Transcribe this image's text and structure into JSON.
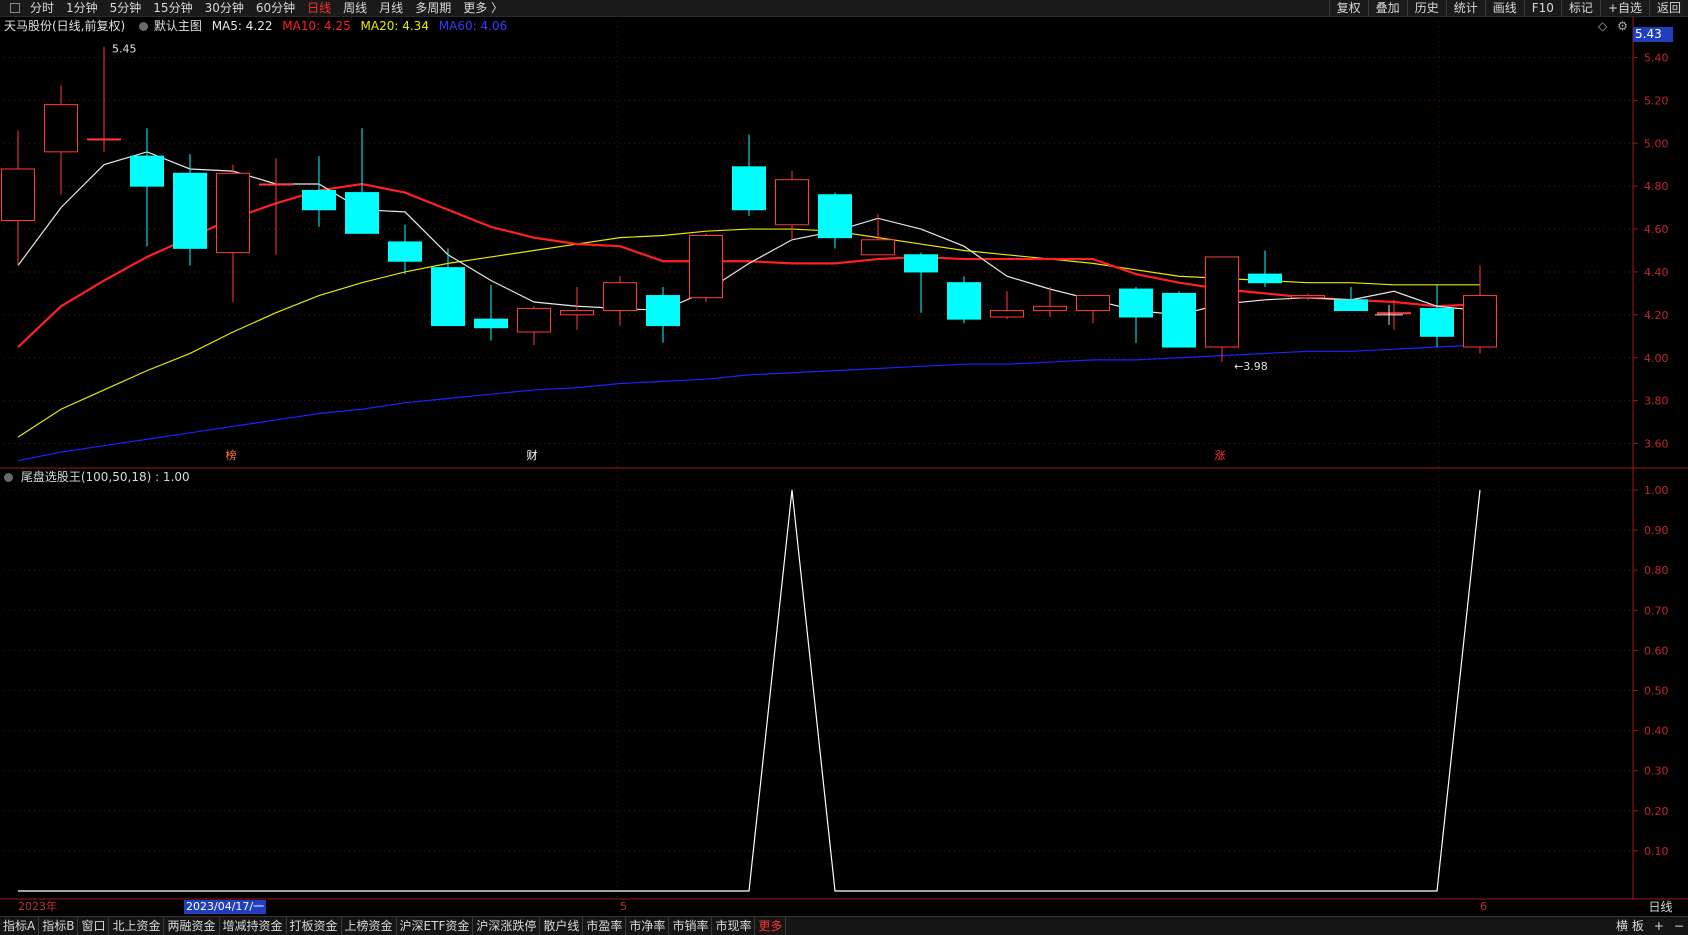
{
  "topbar": {
    "periods": [
      "分时",
      "1分钟",
      "5分钟",
      "15分钟",
      "30分钟",
      "60分钟",
      "日线",
      "周线",
      "月线",
      "多周期",
      "更多 〉"
    ],
    "active_period": "日线",
    "right_buttons": [
      "复权",
      "叠加",
      "历史",
      "统计",
      "画线",
      "F10",
      "标记",
      "+自选",
      "返回"
    ]
  },
  "legend": {
    "stock": "天马股份(日线,前复权)",
    "main_label": "默认主图",
    "ma5": "MA5: 4.22",
    "ma10": "MA10: 4.25",
    "ma20": "MA20: 4.34",
    "ma60": "MA60: 4.06"
  },
  "colors": {
    "up": "#ff3b3b",
    "down": "#00ffff",
    "ma5": "#e8e8e8",
    "ma10": "#ff2020",
    "ma20": "#e8e800",
    "ma60": "#2020ff",
    "axis": "#a01818"
  },
  "price_tag": "5.43",
  "high_label": "5.45",
  "low_label": "←3.98",
  "markers": [
    "榜",
    "财",
    "涨"
  ],
  "sub_indicator": {
    "label": "尾盘选股王(100,50,18) : 1.00"
  },
  "x_axis": {
    "year": "2023年",
    "cursor_date": "2023/04/17/一",
    "month5": "5",
    "month6": "6"
  },
  "period_button": "日线",
  "bottombar": {
    "tabs": [
      "指标A",
      "指标B",
      "窗口",
      "北上资金",
      "两融资金",
      "增减持资金",
      "打板资金",
      "上榜资金",
      "沪深ETF资金",
      "沪深涨跌停",
      "散户线",
      "市盈率",
      "市净率",
      "市销率",
      "市现率",
      "更多"
    ],
    "right": [
      "横 板",
      "+",
      "−"
    ]
  },
  "chart_data": [
    {
      "type": "candlestick",
      "title": "天马股份(日线,前复权)",
      "ylim": [
        3.5,
        5.5
      ],
      "yticks": [
        "5.40",
        "5.20",
        "5.00",
        "4.80",
        "4.60",
        "4.40",
        "4.20",
        "4.00",
        "3.80",
        "3.60"
      ],
      "candles": [
        {
          "o": 4.64,
          "h": 5.06,
          "l": 4.43,
          "c": 4.88
        },
        {
          "o": 4.96,
          "h": 5.27,
          "l": 4.76,
          "c": 5.18
        },
        {
          "o": 5.02,
          "h": 5.45,
          "l": 4.96,
          "c": 5.02
        },
        {
          "o": 4.94,
          "h": 5.07,
          "l": 4.52,
          "c": 4.8
        },
        {
          "o": 4.86,
          "h": 4.95,
          "l": 4.43,
          "c": 4.51
        },
        {
          "o": 4.49,
          "h": 4.9,
          "l": 4.26,
          "c": 4.86
        },
        {
          "o": 4.81,
          "h": 4.93,
          "l": 4.48,
          "c": 4.81
        },
        {
          "o": 4.78,
          "h": 4.94,
          "l": 4.61,
          "c": 4.69
        },
        {
          "o": 4.77,
          "h": 5.07,
          "l": 4.58,
          "c": 4.58
        },
        {
          "o": 4.54,
          "h": 4.62,
          "l": 4.39,
          "c": 4.45
        },
        {
          "o": 4.42,
          "h": 4.51,
          "l": 4.18,
          "c": 4.15
        },
        {
          "o": 4.18,
          "h": 4.34,
          "l": 4.08,
          "c": 4.14
        },
        {
          "o": 4.12,
          "h": 4.24,
          "l": 4.06,
          "c": 4.23
        },
        {
          "o": 4.2,
          "h": 4.33,
          "l": 4.13,
          "c": 4.22
        },
        {
          "o": 4.22,
          "h": 4.38,
          "l": 4.15,
          "c": 4.35
        },
        {
          "o": 4.29,
          "h": 4.33,
          "l": 4.07,
          "c": 4.15
        },
        {
          "o": 4.28,
          "h": 4.58,
          "l": 4.26,
          "c": 4.57
        },
        {
          "o": 4.89,
          "h": 5.04,
          "l": 4.66,
          "c": 4.69
        },
        {
          "o": 4.62,
          "h": 4.87,
          "l": 4.55,
          "c": 4.83
        },
        {
          "o": 4.76,
          "h": 4.77,
          "l": 4.51,
          "c": 4.56
        },
        {
          "o": 4.48,
          "h": 4.67,
          "l": 4.48,
          "c": 4.55
        },
        {
          "o": 4.48,
          "h": 4.49,
          "l": 4.21,
          "c": 4.4
        },
        {
          "o": 4.35,
          "h": 4.38,
          "l": 4.16,
          "c": 4.18
        },
        {
          "o": 4.19,
          "h": 4.31,
          "l": 4.18,
          "c": 4.22
        },
        {
          "o": 4.22,
          "h": 4.33,
          "l": 4.19,
          "c": 4.24
        },
        {
          "o": 4.22,
          "h": 4.29,
          "l": 4.16,
          "c": 4.29
        },
        {
          "o": 4.32,
          "h": 4.33,
          "l": 4.07,
          "c": 4.19
        },
        {
          "o": 4.3,
          "h": 4.31,
          "l": 4.05,
          "c": 4.05
        },
        {
          "o": 4.05,
          "h": 4.47,
          "l": 3.98,
          "c": 4.47
        },
        {
          "o": 4.39,
          "h": 4.5,
          "l": 4.33,
          "c": 4.35
        },
        {
          "o": 4.28,
          "h": 4.3,
          "l": 4.27,
          "c": 4.29
        },
        {
          "o": 4.27,
          "h": 4.33,
          "l": 4.22,
          "c": 4.22
        },
        {
          "o": 4.21,
          "h": 4.27,
          "l": 4.13,
          "c": 4.21
        },
        {
          "o": 4.23,
          "h": 4.34,
          "l": 4.05,
          "c": 4.1
        },
        {
          "o": 4.05,
          "h": 4.43,
          "l": 4.02,
          "c": 4.29
        }
      ],
      "ma5": [
        4.43,
        4.7,
        4.9,
        4.96,
        4.88,
        4.87,
        4.81,
        4.81,
        4.69,
        4.68,
        4.48,
        4.36,
        4.26,
        4.24,
        4.23,
        4.22,
        4.31,
        4.44,
        4.55,
        4.59,
        4.65,
        4.6,
        4.52,
        4.38,
        4.32,
        4.27,
        4.22,
        4.2,
        4.25,
        4.27,
        4.28,
        4.27,
        4.31,
        4.24,
        4.22
      ],
      "ma10": [
        4.05,
        4.24,
        4.36,
        4.47,
        4.56,
        4.65,
        4.72,
        4.78,
        4.81,
        4.77,
        4.69,
        4.61,
        4.56,
        4.53,
        4.52,
        4.45,
        4.45,
        4.45,
        4.44,
        4.44,
        4.46,
        4.47,
        4.46,
        4.46,
        4.46,
        4.46,
        4.39,
        4.35,
        4.32,
        4.3,
        4.28,
        4.27,
        4.26,
        4.24,
        4.25
      ],
      "ma20": [
        3.63,
        3.76,
        3.85,
        3.94,
        4.02,
        4.12,
        4.21,
        4.29,
        4.35,
        4.4,
        4.44,
        4.47,
        4.5,
        4.53,
        4.56,
        4.57,
        4.59,
        4.6,
        4.6,
        4.59,
        4.56,
        4.53,
        4.5,
        4.48,
        4.46,
        4.44,
        4.41,
        4.38,
        4.37,
        4.36,
        4.35,
        4.35,
        4.34,
        4.34,
        4.34
      ],
      "ma60": [
        3.52,
        3.56,
        3.59,
        3.62,
        3.65,
        3.68,
        3.71,
        3.74,
        3.76,
        3.79,
        3.81,
        3.83,
        3.85,
        3.86,
        3.88,
        3.89,
        3.9,
        3.92,
        3.93,
        3.94,
        3.95,
        3.96,
        3.97,
        3.97,
        3.98,
        3.99,
        3.99,
        4.0,
        4.01,
        4.02,
        4.03,
        4.03,
        4.04,
        4.05,
        4.06
      ]
    },
    {
      "type": "line",
      "title": "尾盘选股王(100,50,18)",
      "ylim": [
        0,
        1.0
      ],
      "yticks": [
        "1.00",
        "0.90",
        "0.80",
        "0.70",
        "0.60",
        "0.50",
        "0.40",
        "0.30",
        "0.20",
        "0.10"
      ],
      "values": [
        0,
        0,
        0,
        0,
        0,
        0,
        0,
        0,
        0,
        0,
        0,
        0,
        0,
        0,
        0,
        0,
        0,
        0,
        1,
        0,
        0,
        0,
        0,
        0,
        0,
        0,
        0,
        0,
        0,
        0,
        0,
        0,
        0,
        0,
        1
      ]
    }
  ]
}
